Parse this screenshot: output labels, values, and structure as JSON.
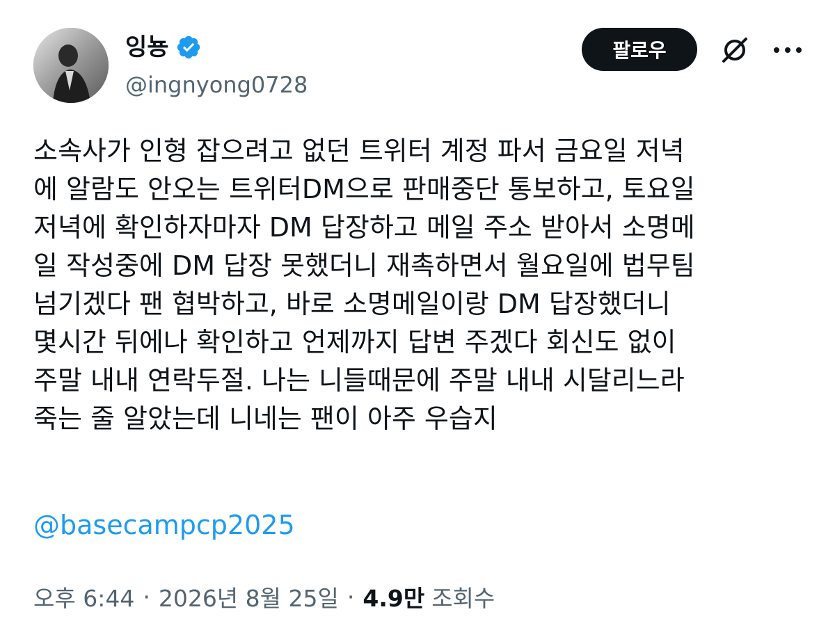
{
  "user": {
    "display_name": "잉뇽",
    "handle": "@ingnyong0728",
    "verified_icon": "verified-badge-icon",
    "avatar_icon": "avatar-photo"
  },
  "actions": {
    "follow_label": "팔로우",
    "grok_icon": "grok-icon",
    "more_icon": "more-icon"
  },
  "tweet": {
    "lines": [
      "소속사가 인형 잡으려고 없던 트위터 계정 파서 금요일 저녁",
      "에 알람도 안오는 트위터DM으로 판매중단 통보하고, 토요일",
      "저녁에 확인하자마자 DM 답장하고 메일 주소 받아서 소명메",
      "일 작성중에 DM 답장 못했더니 재촉하면서 월요일에 법무팀",
      "넘기겠다 팬 협박하고, 바로 소명메일이랑 DM 답장했더니",
      "몇시간 뒤에나 확인하고 언제까지 답변 주겠다 회신도 없이",
      "주말 내내 연락두절. 나는 니들때문에 주말 내내 시달리느라",
      "죽는 줄 알았는데 니네는 팬이 아주 우습지"
    ],
    "mention": "@basecampcp2025"
  },
  "meta": {
    "time": "오후 6:44",
    "date": "2026년 8월 25일",
    "separator": "·",
    "views_count": "4.9만",
    "views_label": "조회수"
  },
  "colors": {
    "text": "#0f1419",
    "secondary": "#536471",
    "accent": "#1d9bf0",
    "button_bg": "#0f1419"
  }
}
